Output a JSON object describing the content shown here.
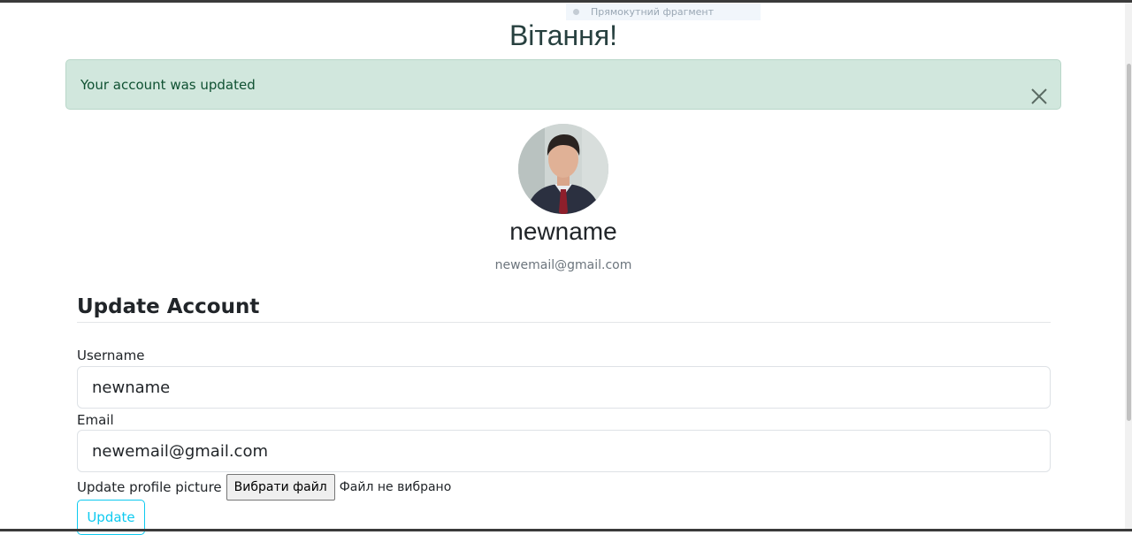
{
  "header": {
    "title": "Вітання!"
  },
  "overlay": {
    "snip_hint": "Прямокутний фрагмент"
  },
  "alert": {
    "message": "Your account was updated",
    "color": "#d1e7dd",
    "text_color": "#0f5132"
  },
  "profile": {
    "username": "newname",
    "email": "newemail@gmail.com",
    "avatar_icon": "user-avatar-photo"
  },
  "form": {
    "section_title": "Update Account",
    "username": {
      "label": "Username",
      "value": "newname"
    },
    "email": {
      "label": "Email",
      "value": "newemail@gmail.com"
    },
    "picture": {
      "label": "Update profile picture",
      "button_label": "Вибрати файл",
      "status": "Файл не вибрано"
    },
    "submit_label": "Update",
    "accent": "#0dcaf0"
  }
}
